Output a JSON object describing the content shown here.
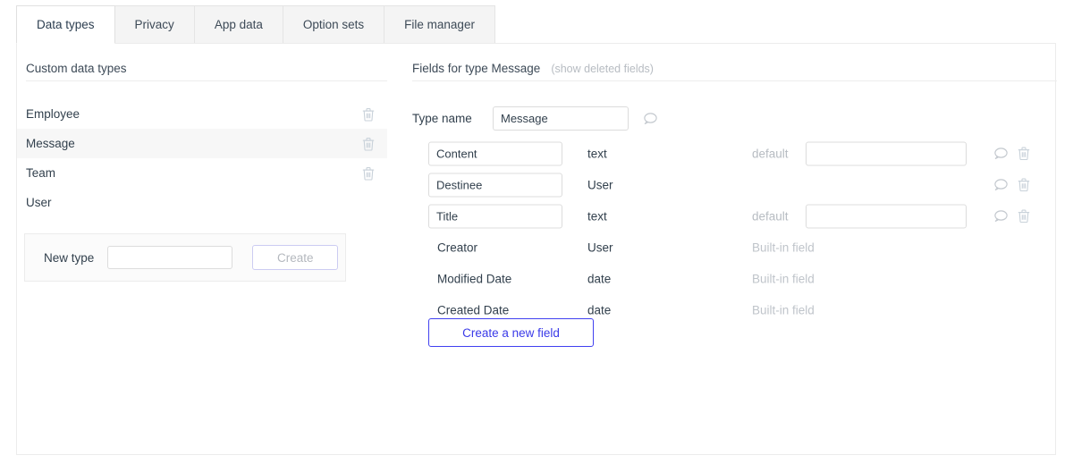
{
  "tabs": [
    {
      "label": "Data types",
      "active": true
    },
    {
      "label": "Privacy",
      "active": false
    },
    {
      "label": "App data",
      "active": false
    },
    {
      "label": "Option sets",
      "active": false
    },
    {
      "label": "File manager",
      "active": false
    }
  ],
  "left_panel": {
    "title": "Custom data types",
    "types": [
      {
        "name": "Employee",
        "selected": false,
        "deletable": true
      },
      {
        "name": "Message",
        "selected": true,
        "deletable": true
      },
      {
        "name": "Team",
        "selected": false,
        "deletable": true
      },
      {
        "name": "User",
        "selected": false,
        "deletable": false
      }
    ],
    "new_type": {
      "label": "New type",
      "value": "",
      "placeholder": "",
      "create_label": "Create",
      "create_disabled": true
    }
  },
  "right_panel": {
    "title": "Fields for type Message",
    "show_deleted_link": "(show deleted fields)",
    "type_name": {
      "label": "Type name",
      "value": "Message",
      "placeholder": ""
    },
    "default_label": "default",
    "builtin_label": "Built-in field",
    "fields": [
      {
        "name": "Content",
        "type": "text",
        "editable": true,
        "has_default": true,
        "default_value": "",
        "builtin": false
      },
      {
        "name": "Destinee",
        "type": "User",
        "editable": true,
        "has_default": false,
        "default_value": "",
        "builtin": false
      },
      {
        "name": "Title",
        "type": "text",
        "editable": true,
        "has_default": true,
        "default_value": "",
        "builtin": false
      },
      {
        "name": "Creator",
        "type": "User",
        "editable": false,
        "has_default": false,
        "default_value": "",
        "builtin": true
      },
      {
        "name": "Modified Date",
        "type": "date",
        "editable": false,
        "has_default": false,
        "default_value": "",
        "builtin": true
      },
      {
        "name": "Created Date",
        "type": "date",
        "editable": false,
        "has_default": false,
        "default_value": "",
        "builtin": true
      }
    ],
    "create_field_label": "Create a new field"
  },
  "icons": {
    "trash": "trash-icon",
    "comment": "comment-icon"
  },
  "colors": {
    "accent": "#3a3ae8",
    "tab_active_bg": "#ffffff",
    "tab_inactive_bg": "#f4f4f4",
    "selected_row_bg": "#f7f7f7",
    "muted_text": "#b7bcc2"
  }
}
